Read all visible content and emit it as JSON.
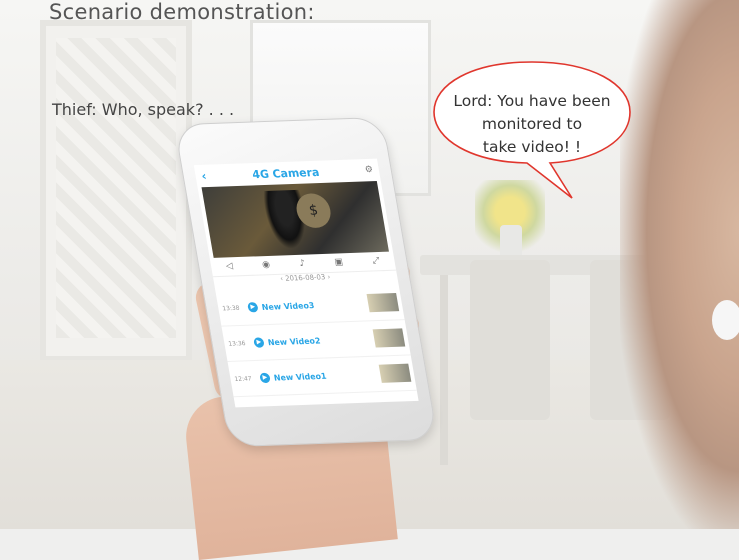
{
  "heading": "Scenario demonstration:",
  "thief_line": "Thief: Who, speak? . . .",
  "bubble": {
    "lines": [
      "Lord: You have been",
      "monitored to",
      "take video! !"
    ],
    "border_color": "#e0362d"
  },
  "app": {
    "title": "4G Camera",
    "back_icon": "chevron-left-icon",
    "settings_icon": "gear-icon",
    "date": "2016-08-03",
    "videos": [
      {
        "time": "13:38",
        "label": "New Video3"
      },
      {
        "time": "13:36",
        "label": "New Video2"
      },
      {
        "time": "12:47",
        "label": "New Video1"
      }
    ],
    "accent": "#2aa6e6"
  }
}
